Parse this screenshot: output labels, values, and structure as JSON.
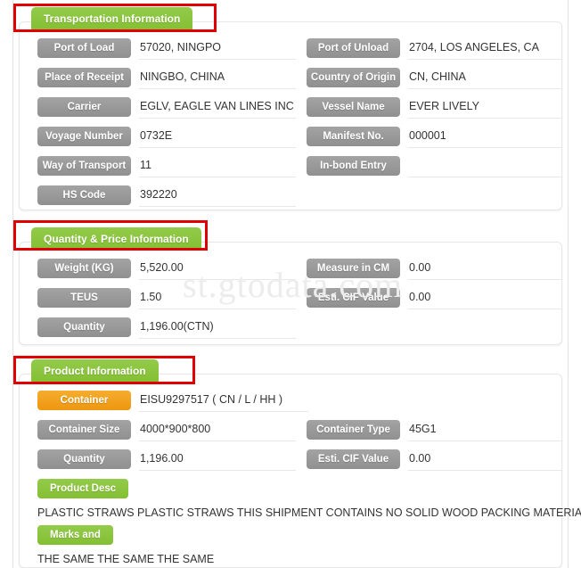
{
  "watermark": "st.gtodata.com",
  "colors": {
    "section_tab_green": "#8cc63e",
    "field_label_gray": "#9a9a9a",
    "container_label_orange": "#f2a11c",
    "annotation_red": "#e00000",
    "value_text": "#333333",
    "watermark_gray": "#ececec"
  },
  "sections": [
    {
      "id": "transportation",
      "title": "Transportation Information",
      "highlighted": true,
      "left_fields": [
        {
          "label": "Port of Load",
          "value": "57020, NINGPO"
        },
        {
          "label": "Place of Receipt",
          "value": "NINGBO, CHINA"
        },
        {
          "label": "Carrier",
          "value": "EGLV, EAGLE VAN LINES INC"
        },
        {
          "label": "Voyage Number",
          "value": "0732E"
        },
        {
          "label": "Way of Transport",
          "value": "11"
        },
        {
          "label": "HS Code",
          "value": "392220"
        }
      ],
      "right_fields": [
        {
          "label": "Port of Unload",
          "value": "2704, LOS ANGELES, CA"
        },
        {
          "label": "Country of Origin",
          "value": "CN, CHINA"
        },
        {
          "label": "Vessel Name",
          "value": "EVER LIVELY"
        },
        {
          "label": "Manifest No.",
          "value": "000001"
        },
        {
          "label": "In-bond Entry",
          "value": ""
        }
      ]
    },
    {
      "id": "quantity-price",
      "title": "Quantity & Price Information",
      "highlighted": true,
      "left_fields": [
        {
          "label": "Weight (KG)",
          "value": "5,520.00"
        },
        {
          "label": "TEUS",
          "value": "1.50"
        },
        {
          "label": "Quantity",
          "value": "1,196.00(CTN)"
        }
      ],
      "right_fields": [
        {
          "label": "Measure in CM",
          "value": "0.00"
        },
        {
          "label": "Esti. CIF Value",
          "value": "0.00"
        }
      ]
    },
    {
      "id": "product",
      "title": "Product Information",
      "highlighted": true,
      "left_fields": [
        {
          "label": "Container",
          "value": "EISU9297517 ( CN / L / HH )",
          "style": "orange"
        },
        {
          "label": "Container Size",
          "value": "4000*900*800"
        },
        {
          "label": "Quantity",
          "value": "1,196.00"
        }
      ],
      "right_fields": [
        {
          "label": "Container Type",
          "value": "45G1"
        },
        {
          "label": "Esti. CIF Value",
          "value": "0.00"
        }
      ],
      "full_fields": [
        {
          "label": "Product Desc",
          "value": "PLASTIC STRAWS PLASTIC STRAWS THIS SHIPMENT CONTAINS NO SOLID WOOD PACKING MATERIALS."
        },
        {
          "label": "Marks and",
          "value": "THE SAME THE SAME THE SAME"
        }
      ]
    }
  ]
}
